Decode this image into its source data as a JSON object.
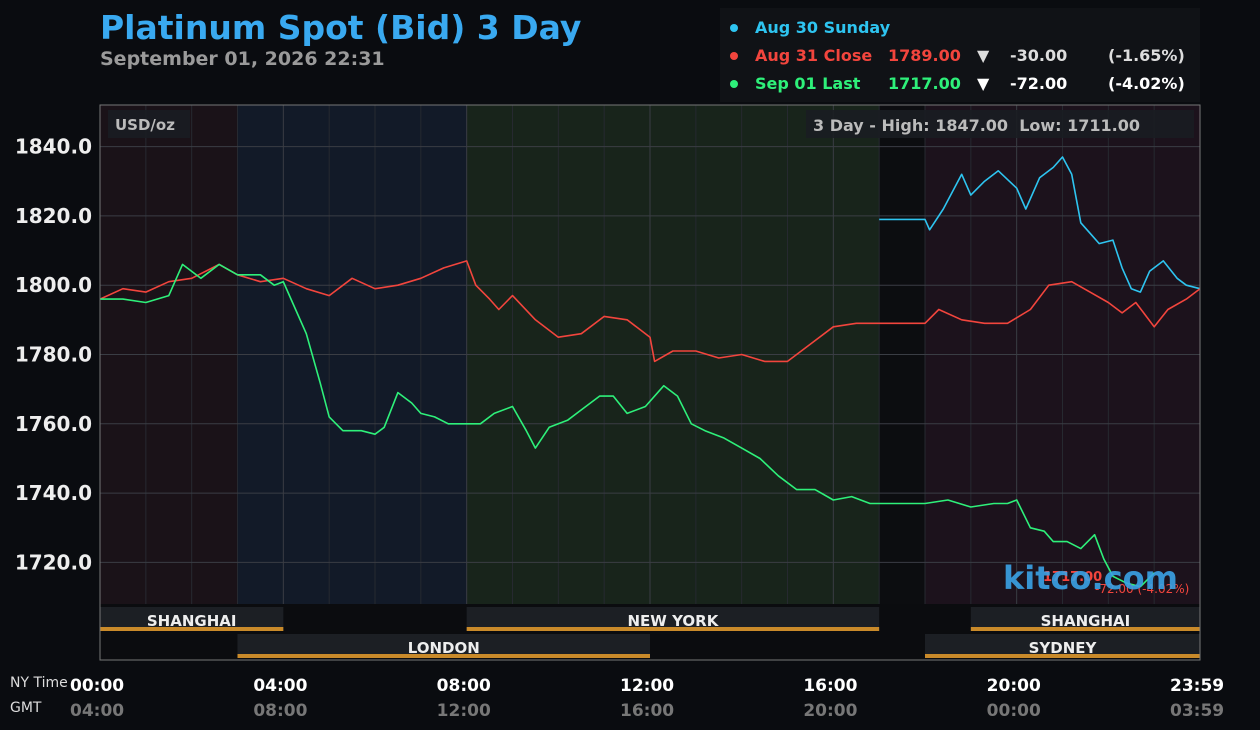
{
  "header": {
    "title": "Platinum Spot (Bid) 3 Day",
    "subtitle": "September 01, 2026 22:31"
  },
  "legend": [
    {
      "label": "Aug 30 Sunday",
      "price": "",
      "arrow": "",
      "change": "",
      "pct": "",
      "color": "#2ec4f0"
    },
    {
      "label": "Aug 31 Close",
      "price": "1789.00",
      "arrow": "▼",
      "change": "-30.00",
      "pct": "(-1.65%)",
      "color": "#f2453d"
    },
    {
      "label": "Sep 01 Last",
      "price": "1717.00",
      "arrow": "▼",
      "change": "-72.00",
      "pct": "(-4.02%)",
      "color": "#2ef07a"
    }
  ],
  "labels": {
    "unit": "USD/oz",
    "range": "3 Day - High: 1847.00  Low: 1711.00",
    "watermark": "kitco.com",
    "last_price": "1717.00",
    "last_change": "-72.00 (-4.02%)",
    "ny_time": "NY Time",
    "gmt": "GMT"
  },
  "sessions": [
    {
      "name": "SHANGHAI",
      "start": 0,
      "end": 4,
      "row": 1
    },
    {
      "name": "NEW YORK",
      "start": 8,
      "end": 17,
      "row": 1
    },
    {
      "name": "SHANGHAI",
      "start": 19,
      "end": 24,
      "row": 1
    },
    {
      "name": "LONDON",
      "start": 3,
      "end": 12,
      "row": 2
    },
    {
      "name": "SYDNEY",
      "start": 18,
      "end": 24,
      "row": 2
    }
  ],
  "x_ticks": [
    {
      "ny": "00:00",
      "gmt": "04:00",
      "h": 0
    },
    {
      "ny": "04:00",
      "gmt": "08:00",
      "h": 4
    },
    {
      "ny": "08:00",
      "gmt": "12:00",
      "h": 8
    },
    {
      "ny": "12:00",
      "gmt": "16:00",
      "h": 12
    },
    {
      "ny": "16:00",
      "gmt": "20:00",
      "h": 16
    },
    {
      "ny": "20:00",
      "gmt": "00:00",
      "h": 20
    },
    {
      "ny": "23:59",
      "gmt": "03:59",
      "h": 24
    }
  ],
  "chart_data": {
    "type": "line",
    "title": "Platinum Spot (Bid) 3 Day",
    "ylabel": "USD/oz",
    "x_unit": "NY time (hours)",
    "xlim": [
      0,
      24
    ],
    "ylim": [
      1708,
      1852
    ],
    "y_ticks": [
      1720.0,
      1740.0,
      1760.0,
      1780.0,
      1800.0,
      1820.0,
      1840.0
    ],
    "grid": true,
    "high": 1847.0,
    "low": 1711.0,
    "series": [
      {
        "name": "Aug 30 Sunday",
        "color": "#2ec4f0",
        "points": [
          [
            17.0,
            1819
          ],
          [
            18.0,
            1819
          ],
          [
            18.1,
            1816
          ],
          [
            18.4,
            1822
          ],
          [
            18.8,
            1832
          ],
          [
            19.0,
            1826
          ],
          [
            19.3,
            1830
          ],
          [
            19.6,
            1833
          ],
          [
            20.0,
            1828
          ],
          [
            20.2,
            1822
          ],
          [
            20.5,
            1831
          ],
          [
            20.8,
            1834
          ],
          [
            21.0,
            1837
          ],
          [
            21.2,
            1832
          ],
          [
            21.4,
            1818
          ],
          [
            21.6,
            1815
          ],
          [
            21.8,
            1812
          ],
          [
            22.1,
            1813
          ],
          [
            22.3,
            1805
          ],
          [
            22.5,
            1799
          ],
          [
            22.7,
            1798
          ],
          [
            22.9,
            1804
          ],
          [
            23.2,
            1807
          ],
          [
            23.5,
            1802
          ],
          [
            23.7,
            1800
          ],
          [
            24.0,
            1799
          ]
        ]
      },
      {
        "name": "Aug 31 Close",
        "color": "#f2453d",
        "points": [
          [
            0.0,
            1796
          ],
          [
            0.5,
            1799
          ],
          [
            1.0,
            1798
          ],
          [
            1.5,
            1801
          ],
          [
            2.0,
            1802
          ],
          [
            2.6,
            1806
          ],
          [
            3.0,
            1803
          ],
          [
            3.5,
            1801
          ],
          [
            4.0,
            1802
          ],
          [
            4.5,
            1799
          ],
          [
            5.0,
            1797
          ],
          [
            5.5,
            1802
          ],
          [
            6.0,
            1799
          ],
          [
            6.5,
            1800
          ],
          [
            7.0,
            1802
          ],
          [
            7.5,
            1805
          ],
          [
            8.0,
            1807
          ],
          [
            8.2,
            1800
          ],
          [
            8.5,
            1796
          ],
          [
            8.7,
            1793
          ],
          [
            9.0,
            1797
          ],
          [
            9.5,
            1790
          ],
          [
            10.0,
            1785
          ],
          [
            10.5,
            1786
          ],
          [
            11.0,
            1791
          ],
          [
            11.5,
            1790
          ],
          [
            12.0,
            1785
          ],
          [
            12.1,
            1778
          ],
          [
            12.5,
            1781
          ],
          [
            13.0,
            1781
          ],
          [
            13.5,
            1779
          ],
          [
            14.0,
            1780
          ],
          [
            14.5,
            1778
          ],
          [
            15.0,
            1778
          ],
          [
            15.5,
            1783
          ],
          [
            16.0,
            1788
          ],
          [
            16.5,
            1789
          ],
          [
            17.0,
            1789
          ],
          [
            18.0,
            1789
          ],
          [
            18.3,
            1793
          ],
          [
            18.8,
            1790
          ],
          [
            19.3,
            1789
          ],
          [
            19.8,
            1789
          ],
          [
            20.3,
            1793
          ],
          [
            20.7,
            1800
          ],
          [
            21.2,
            1801
          ],
          [
            21.6,
            1798
          ],
          [
            22.0,
            1795
          ],
          [
            22.3,
            1792
          ],
          [
            22.6,
            1795
          ],
          [
            23.0,
            1788
          ],
          [
            23.3,
            1793
          ],
          [
            23.7,
            1796
          ],
          [
            24.0,
            1799
          ]
        ]
      },
      {
        "name": "Sep 01 Last",
        "color": "#2ef07a",
        "points": [
          [
            0.0,
            1796
          ],
          [
            0.5,
            1796
          ],
          [
            1.0,
            1795
          ],
          [
            1.5,
            1797
          ],
          [
            1.8,
            1806
          ],
          [
            2.2,
            1802
          ],
          [
            2.6,
            1806
          ],
          [
            3.0,
            1803
          ],
          [
            3.5,
            1803
          ],
          [
            3.8,
            1800
          ],
          [
            4.0,
            1801
          ],
          [
            4.2,
            1795
          ],
          [
            4.5,
            1786
          ],
          [
            4.8,
            1772
          ],
          [
            5.0,
            1762
          ],
          [
            5.3,
            1758
          ],
          [
            5.7,
            1758
          ],
          [
            6.0,
            1757
          ],
          [
            6.2,
            1759
          ],
          [
            6.5,
            1769
          ],
          [
            6.8,
            1766
          ],
          [
            7.0,
            1763
          ],
          [
            7.3,
            1762
          ],
          [
            7.6,
            1760
          ],
          [
            8.0,
            1760
          ],
          [
            8.3,
            1760
          ],
          [
            8.6,
            1763
          ],
          [
            9.0,
            1765
          ],
          [
            9.3,
            1758
          ],
          [
            9.5,
            1753
          ],
          [
            9.8,
            1759
          ],
          [
            10.2,
            1761
          ],
          [
            10.5,
            1764
          ],
          [
            10.9,
            1768
          ],
          [
            11.2,
            1768
          ],
          [
            11.5,
            1763
          ],
          [
            11.9,
            1765
          ],
          [
            12.3,
            1771
          ],
          [
            12.6,
            1768
          ],
          [
            12.9,
            1760
          ],
          [
            13.2,
            1758
          ],
          [
            13.6,
            1756
          ],
          [
            14.0,
            1753
          ],
          [
            14.4,
            1750
          ],
          [
            14.8,
            1745
          ],
          [
            15.2,
            1741
          ],
          [
            15.6,
            1741
          ],
          [
            16.0,
            1738
          ],
          [
            16.4,
            1739
          ],
          [
            16.8,
            1737
          ],
          [
            17.0,
            1737
          ],
          [
            18.0,
            1737
          ],
          [
            18.5,
            1738
          ],
          [
            19.0,
            1736
          ],
          [
            19.5,
            1737
          ],
          [
            19.8,
            1737
          ],
          [
            20.0,
            1738
          ],
          [
            20.3,
            1730
          ],
          [
            20.6,
            1729
          ],
          [
            20.8,
            1726
          ],
          [
            21.1,
            1726
          ],
          [
            21.4,
            1724
          ],
          [
            21.7,
            1728
          ],
          [
            21.9,
            1721
          ],
          [
            22.1,
            1716
          ],
          [
            22.4,
            1714
          ],
          [
            22.7,
            1713
          ],
          [
            23.0,
            1717
          ]
        ]
      }
    ]
  }
}
